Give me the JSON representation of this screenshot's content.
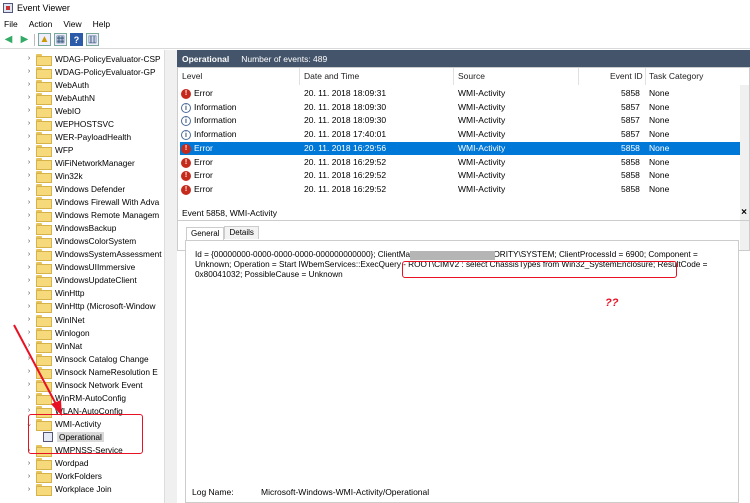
{
  "window": {
    "title": "Event Viewer"
  },
  "menu": [
    "File",
    "Action",
    "View",
    "Help"
  ],
  "tree": {
    "items": [
      {
        "label": "WDAG-PolicyEvaluator-CSP",
        "expanded": false
      },
      {
        "label": "WDAG-PolicyEvaluator-GP",
        "expanded": false
      },
      {
        "label": "WebAuth",
        "expanded": false
      },
      {
        "label": "WebAuthN",
        "expanded": false
      },
      {
        "label": "WebIO",
        "expanded": false
      },
      {
        "label": "WEPHOSTSVC",
        "expanded": false
      },
      {
        "label": "WER-PayloadHealth",
        "expanded": false
      },
      {
        "label": "WFP",
        "expanded": false
      },
      {
        "label": "WiFiNetworkManager",
        "expanded": false
      },
      {
        "label": "Win32k",
        "expanded": false
      },
      {
        "label": "Windows Defender",
        "expanded": false
      },
      {
        "label": "Windows Firewall With Adva",
        "expanded": false
      },
      {
        "label": "Windows Remote Managem",
        "expanded": false
      },
      {
        "label": "WindowsBackup",
        "expanded": false
      },
      {
        "label": "WindowsColorSystem",
        "expanded": false
      },
      {
        "label": "WindowsSystemAssessment",
        "expanded": false
      },
      {
        "label": "WindowsUIImmersive",
        "expanded": false
      },
      {
        "label": "WindowsUpdateClient",
        "expanded": false
      },
      {
        "label": "WinHttp",
        "expanded": false
      },
      {
        "label": "WinHttp (Microsoft-Window",
        "expanded": false
      },
      {
        "label": "WinINet",
        "expanded": false
      },
      {
        "label": "Winlogon",
        "expanded": false
      },
      {
        "label": "WinNat",
        "expanded": false
      },
      {
        "label": "Winsock Catalog Change",
        "expanded": false
      },
      {
        "label": "Winsock NameResolution E",
        "expanded": false
      },
      {
        "label": "Winsock Network Event",
        "expanded": false
      },
      {
        "label": "WinRM-AutoConfig",
        "expanded": false
      },
      {
        "label": "WLAN-AutoConfig",
        "expanded": false
      },
      {
        "label": "WMI-Activity",
        "expanded": true
      },
      {
        "label": "Operational",
        "child": true
      },
      {
        "label": "WMPNSS-Service",
        "expanded": false
      },
      {
        "label": "Wordpad",
        "expanded": false
      },
      {
        "label": "WorkFolders",
        "expanded": false
      },
      {
        "label": "Workplace Join",
        "expanded": false
      }
    ]
  },
  "log": {
    "title": "Operational",
    "count_text": "Number of events: 489"
  },
  "columns": {
    "level": "Level",
    "date": "Date and Time",
    "source": "Source",
    "event_id": "Event ID",
    "task": "Task Category"
  },
  "events": [
    {
      "level": "Error",
      "date": "20. 11. 2018 18:09:31",
      "source": "WMI-Activity",
      "event_id": "5858",
      "task": "None"
    },
    {
      "level": "Information",
      "date": "20. 11. 2018 18:09:30",
      "source": "WMI-Activity",
      "event_id": "5857",
      "task": "None"
    },
    {
      "level": "Information",
      "date": "20. 11. 2018 18:09:30",
      "source": "WMI-Activity",
      "event_id": "5857",
      "task": "None"
    },
    {
      "level": "Information",
      "date": "20. 11. 2018 17:40:01",
      "source": "WMI-Activity",
      "event_id": "5857",
      "task": "None"
    },
    {
      "level": "Error",
      "date": "20. 11. 2018 16:29:56",
      "source": "WMI-Activity",
      "event_id": "5858",
      "task": "None",
      "selected": true
    },
    {
      "level": "Error",
      "date": "20. 11. 2018 16:29:52",
      "source": "WMI-Activity",
      "event_id": "5858",
      "task": "None"
    },
    {
      "level": "Error",
      "date": "20. 11. 2018 16:29:52",
      "source": "WMI-Activity",
      "event_id": "5858",
      "task": "None"
    },
    {
      "level": "Error",
      "date": "20. 11. 2018 16:29:52",
      "source": "WMI-Activity",
      "event_id": "5858",
      "task": "None"
    }
  ],
  "detail": {
    "title": "Event 5858, WMI-Activity",
    "tabs": [
      "General",
      "Details"
    ],
    "description": "Id = {00000000-0000-0000-0000-000000000000}; ClientMachine                              User = NT AUTHORITY\\SYSTEM; ClientProcessId = 6900; Component = Unknown; Operation = Start IWbemServices::ExecQuery - ROOT\\CIMV2 : select ChassisTypes from Win32_SystemEnclosure; ResultCode = 0x80041032; PossibleCause = Unknown",
    "log_name_label": "Log Name:",
    "log_name_value": "Microsoft-Windows-WMI-Activity/Operational"
  },
  "annotation": {
    "text": "??",
    "color": "#e81123"
  }
}
